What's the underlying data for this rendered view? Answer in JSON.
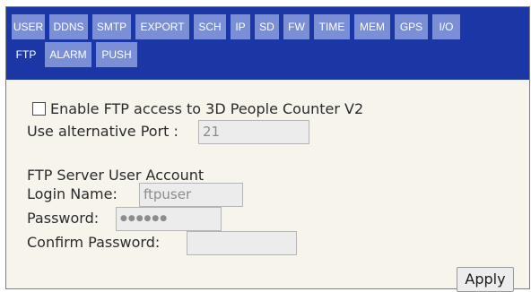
{
  "tabs_row1": [
    {
      "label": "USER",
      "name": "tab-user"
    },
    {
      "label": "DDNS",
      "name": "tab-ddns"
    },
    {
      "label": "SMTP",
      "name": "tab-smtp"
    },
    {
      "label": "EXPORT",
      "name": "tab-export"
    },
    {
      "label": "SCH",
      "name": "tab-sch"
    },
    {
      "label": "IP",
      "name": "tab-ip"
    },
    {
      "label": "SD",
      "name": "tab-sd"
    },
    {
      "label": "FW",
      "name": "tab-fw"
    },
    {
      "label": "TIME",
      "name": "tab-time"
    },
    {
      "label": "MEM",
      "name": "tab-mem"
    },
    {
      "label": "GPS",
      "name": "tab-gps"
    },
    {
      "label": "I/O",
      "name": "tab-io"
    }
  ],
  "tabs_row2": [
    {
      "label": "FTP",
      "name": "tab-ftp",
      "active": true
    },
    {
      "label": "ALARM",
      "name": "tab-alarm"
    },
    {
      "label": "PUSH",
      "name": "tab-push"
    }
  ],
  "ftp": {
    "enable_label": "Enable FTP access to 3D People Counter V2",
    "enable_checked": false,
    "port_label": "Use alternative Port :",
    "port_value": "21",
    "account_heading": "FTP Server User Account",
    "login_label": "Login Name:",
    "login_value": "ftpuser",
    "password_label": "Password:",
    "password_mask": "●●●●●●",
    "confirm_label": "Confirm Password:",
    "confirm_value": "",
    "apply_label": "Apply"
  },
  "colors": {
    "tabbar_bg": "#1b37a6",
    "tab_bg": "#7b8fd7",
    "panel_bg": "#f7f4ec"
  }
}
